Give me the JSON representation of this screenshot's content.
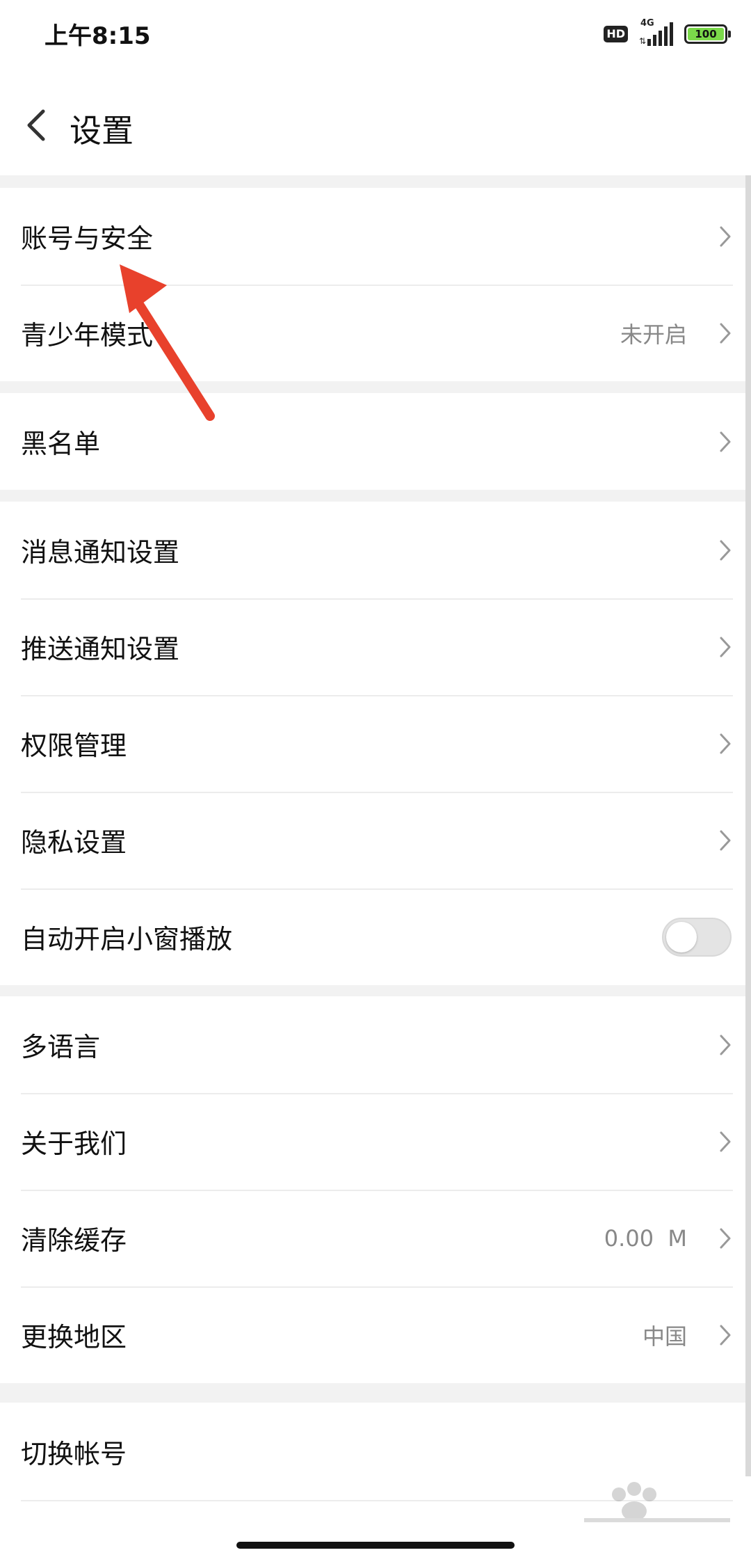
{
  "status_bar": {
    "time": "上午8:15",
    "hd": "HD",
    "network": "4G",
    "battery": "100",
    "battery_color": "#7bd94a"
  },
  "header": {
    "back_icon": "chevron-left-icon",
    "title": "设置"
  },
  "groups": [
    {
      "items": [
        {
          "label": "账号与安全",
          "value": "",
          "control": "chevron"
        },
        {
          "label": "青少年模式",
          "value": "未开启",
          "control": "chevron"
        }
      ]
    },
    {
      "items": [
        {
          "label": "黑名单",
          "value": "",
          "control": "chevron"
        }
      ]
    },
    {
      "items": [
        {
          "label": "消息通知设置",
          "value": "",
          "control": "chevron"
        },
        {
          "label": "推送通知设置",
          "value": "",
          "control": "chevron"
        },
        {
          "label": "权限管理",
          "value": "",
          "control": "chevron"
        },
        {
          "label": "隐私设置",
          "value": "",
          "control": "chevron"
        },
        {
          "label": "自动开启小窗播放",
          "value": "",
          "control": "toggle",
          "toggle_on": false
        }
      ]
    },
    {
      "items": [
        {
          "label": "多语言",
          "value": "",
          "control": "chevron"
        },
        {
          "label": "关于我们",
          "value": "",
          "control": "chevron"
        },
        {
          "label": "清除缓存",
          "value": "0.00  M",
          "control": "chevron"
        },
        {
          "label": "更换地区",
          "value": "中国",
          "control": "chevron"
        }
      ]
    },
    {
      "items": [
        {
          "label": "切换帐号",
          "value": "",
          "control": "none"
        }
      ]
    }
  ],
  "annotation": {
    "icon": "red-arrow-icon",
    "color": "#e8412c"
  },
  "watermark": {
    "icon": "baidu-jingyan-watermark"
  }
}
